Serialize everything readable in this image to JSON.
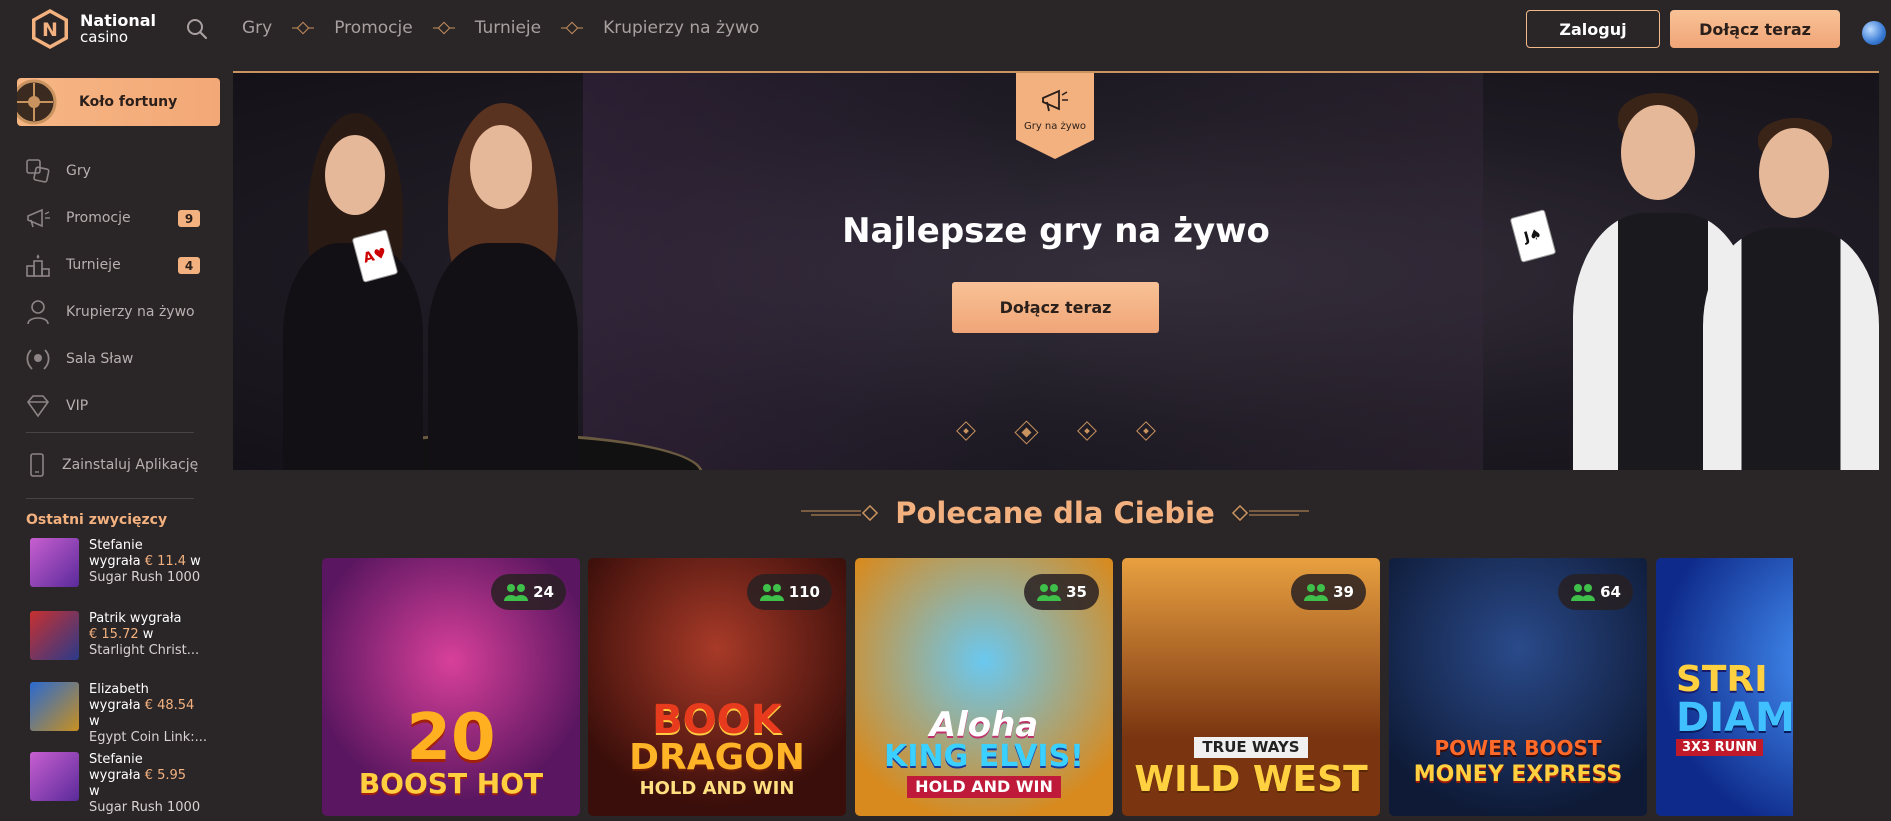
{
  "brand": {
    "line1": "National",
    "line2": "casino",
    "logo_letter": "N",
    "accent": "#f3b17f"
  },
  "topnav": {
    "items": [
      "Gry",
      "Promocje",
      "Turnieje",
      "Krupierzy na żywo"
    ]
  },
  "header": {
    "login_label": "Zaloguj",
    "join_label": "Dołącz teraz"
  },
  "sidebar": {
    "wheel_label": "Koło fortuny",
    "items": [
      {
        "label": "Gry",
        "icon": "games-icon",
        "badge": ""
      },
      {
        "label": "Promocje",
        "icon": "megaphone-icon",
        "badge": "9"
      },
      {
        "label": "Turnieje",
        "icon": "podium-icon",
        "badge": "4"
      },
      {
        "label": "Krupierzy na żywo",
        "icon": "dealer-icon",
        "badge": ""
      },
      {
        "label": "Sala Sław",
        "icon": "laurel-icon",
        "badge": ""
      },
      {
        "label": "VIP",
        "icon": "diamond-icon",
        "badge": ""
      }
    ],
    "install_label": "Zainstaluj Aplikację",
    "winners_title": "Ostatni zwycięzcy",
    "winners": [
      {
        "line1": "Stefanie",
        "line2_pre": "wygrała ",
        "amount": "€ 11.4",
        "line2_post": " w",
        "game": "Sugar Rush 1000"
      },
      {
        "line1": "Patrik wygrała",
        "line2_pre": "",
        "amount": "€ 15.72",
        "line2_post": " w",
        "game": "Starlight Christ..."
      },
      {
        "line1": "Elizabeth",
        "line2_pre": "wygrała ",
        "amount": "€ 48.54",
        "line2_post": "",
        "line3": "w",
        "game": "Egypt Coin Link:..."
      },
      {
        "line1": "Stefanie",
        "line2_pre": "wygrała ",
        "amount": "€ 5.95",
        "line2_post": "",
        "line3": "w",
        "game": "Sugar Rush 1000"
      }
    ]
  },
  "hero": {
    "badge_label": "Gry na żywo",
    "title": "Najlepsze gry na żywo",
    "cta_label": "Dołącz teraz",
    "slides": 4,
    "active_slide": 2
  },
  "recommended": {
    "title": "Polecane dla Ciebie",
    "games": [
      {
        "players": "24",
        "art_line1": "20",
        "art_line2": "BOOST HOT",
        "bg": "#7a1a6e"
      },
      {
        "players": "110",
        "art_line1": "BOOK",
        "art_line2": "DRAGON",
        "art_line3": "HOLD AND WIN",
        "bg": "#6a1e14"
      },
      {
        "players": "35",
        "art_line1": "Aloha",
        "art_line2": "KING ELVIS!",
        "art_line3": "HOLD AND WIN",
        "bg": "#1d7fbf"
      },
      {
        "players": "39",
        "art_line1": "TRUE WAYS",
        "art_line2": "WILD WEST",
        "bg": "#8a4a1c"
      },
      {
        "players": "64",
        "art_line1": "POWER BOOST",
        "art_line2": "MONEY EXPRESS",
        "bg": "#1c2e5a"
      },
      {
        "players": "",
        "art_line1": "STRI",
        "art_line2": "DIAM",
        "art_line3": "3X3 RUNN",
        "bg": "#1a3aa8"
      }
    ]
  }
}
